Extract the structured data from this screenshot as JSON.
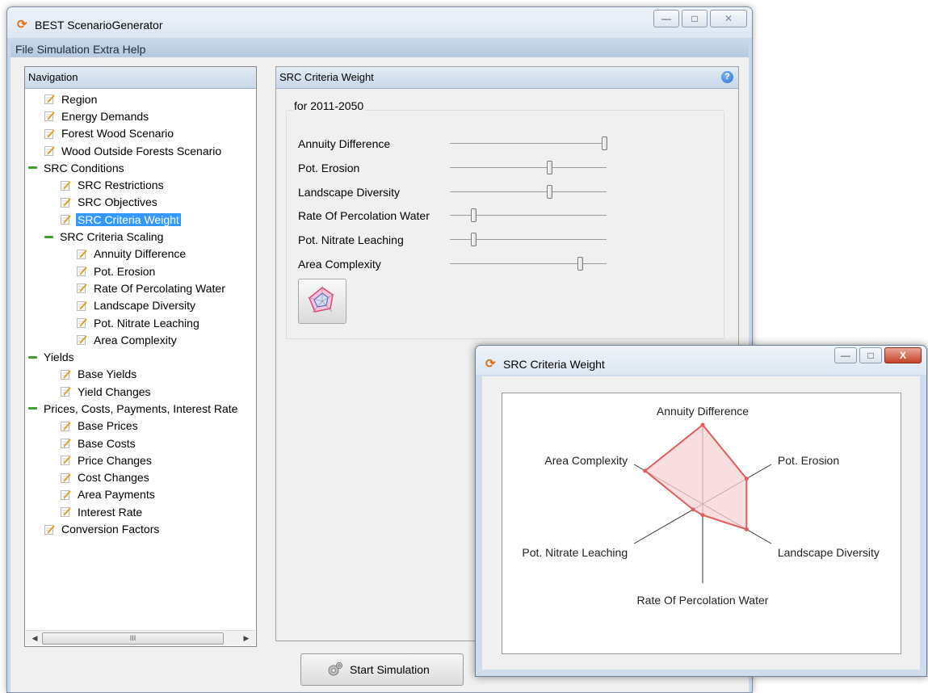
{
  "main_window": {
    "title": "BEST ScenarioGenerator",
    "menu": [
      "File",
      "Simulation",
      "Extra",
      "Help"
    ],
    "navigation": {
      "header": "Navigation",
      "items": [
        {
          "label": "Region",
          "level": 1,
          "type": "doc"
        },
        {
          "label": "Energy Demands",
          "level": 1,
          "type": "doc"
        },
        {
          "label": "Forest Wood Scenario",
          "level": 1,
          "type": "doc"
        },
        {
          "label": "Wood Outside Forests Scenario",
          "level": 1,
          "type": "doc"
        },
        {
          "label": "SRC Conditions",
          "level": 0,
          "type": "group"
        },
        {
          "label": "SRC Restrictions",
          "level": 2,
          "type": "doc"
        },
        {
          "label": "SRC Objectives",
          "level": 2,
          "type": "doc"
        },
        {
          "label": "SRC Criteria Weight",
          "level": 2,
          "type": "doc",
          "selected": true
        },
        {
          "label": "SRC Criteria Scaling",
          "level": 1,
          "type": "group"
        },
        {
          "label": "Annuity Difference",
          "level": 3,
          "type": "doc"
        },
        {
          "label": "Pot. Erosion",
          "level": 3,
          "type": "doc"
        },
        {
          "label": "Rate Of Percolating Water",
          "level": 3,
          "type": "doc"
        },
        {
          "label": "Landscape Diversity",
          "level": 3,
          "type": "doc"
        },
        {
          "label": "Pot. Nitrate Leaching",
          "level": 3,
          "type": "doc"
        },
        {
          "label": "Area Complexity",
          "level": 3,
          "type": "doc"
        },
        {
          "label": "Yields",
          "level": 0,
          "type": "group"
        },
        {
          "label": "Base Yields",
          "level": 2,
          "type": "doc"
        },
        {
          "label": "Yield Changes",
          "level": 2,
          "type": "doc"
        },
        {
          "label": "Prices, Costs, Payments, Interest Rate",
          "level": 0,
          "type": "group"
        },
        {
          "label": "Base Prices",
          "level": 2,
          "type": "doc"
        },
        {
          "label": "Base Costs",
          "level": 2,
          "type": "doc"
        },
        {
          "label": "Price Changes",
          "level": 2,
          "type": "doc"
        },
        {
          "label": "Cost Changes",
          "level": 2,
          "type": "doc"
        },
        {
          "label": "Area Payments",
          "level": 2,
          "type": "doc"
        },
        {
          "label": "Interest Rate",
          "level": 2,
          "type": "doc"
        },
        {
          "label": "Conversion Factors",
          "level": 1,
          "type": "doc"
        }
      ],
      "scrollbar_thumb": "III"
    },
    "content": {
      "header": "SRC Criteria Weight",
      "group_title": "for 2011-2050",
      "sliders": [
        {
          "label": "Annuity Difference",
          "value": 1.0
        },
        {
          "label": "Pot. Erosion",
          "value": 0.64
        },
        {
          "label": "Landscape Diversity",
          "value": 0.64
        },
        {
          "label": "Rate Of Percolation Water",
          "value": 0.14
        },
        {
          "label": "Pot. Nitrate Leaching",
          "value": 0.14
        },
        {
          "label": "Area Complexity",
          "value": 0.84
        }
      ]
    },
    "start_button": "Start Simulation"
  },
  "popup": {
    "title": "SRC Criteria Weight",
    "close_glyph": "X"
  },
  "chart_data": {
    "type": "radar",
    "axes": [
      "Annuity Difference",
      "Pot. Erosion",
      "Landscape Diversity",
      "Rate Of Percolation Water",
      "Pot. Nitrate Leaching",
      "Area Complexity"
    ],
    "values": [
      1.0,
      0.64,
      0.64,
      0.14,
      0.14,
      0.84
    ],
    "fill_color": "#f6d3d3",
    "line_color": "#e55a5a"
  },
  "colors": {
    "selection": "#3399ff",
    "tree_group_icon": "#3e9e2e",
    "app_icon": "#e86b10"
  }
}
